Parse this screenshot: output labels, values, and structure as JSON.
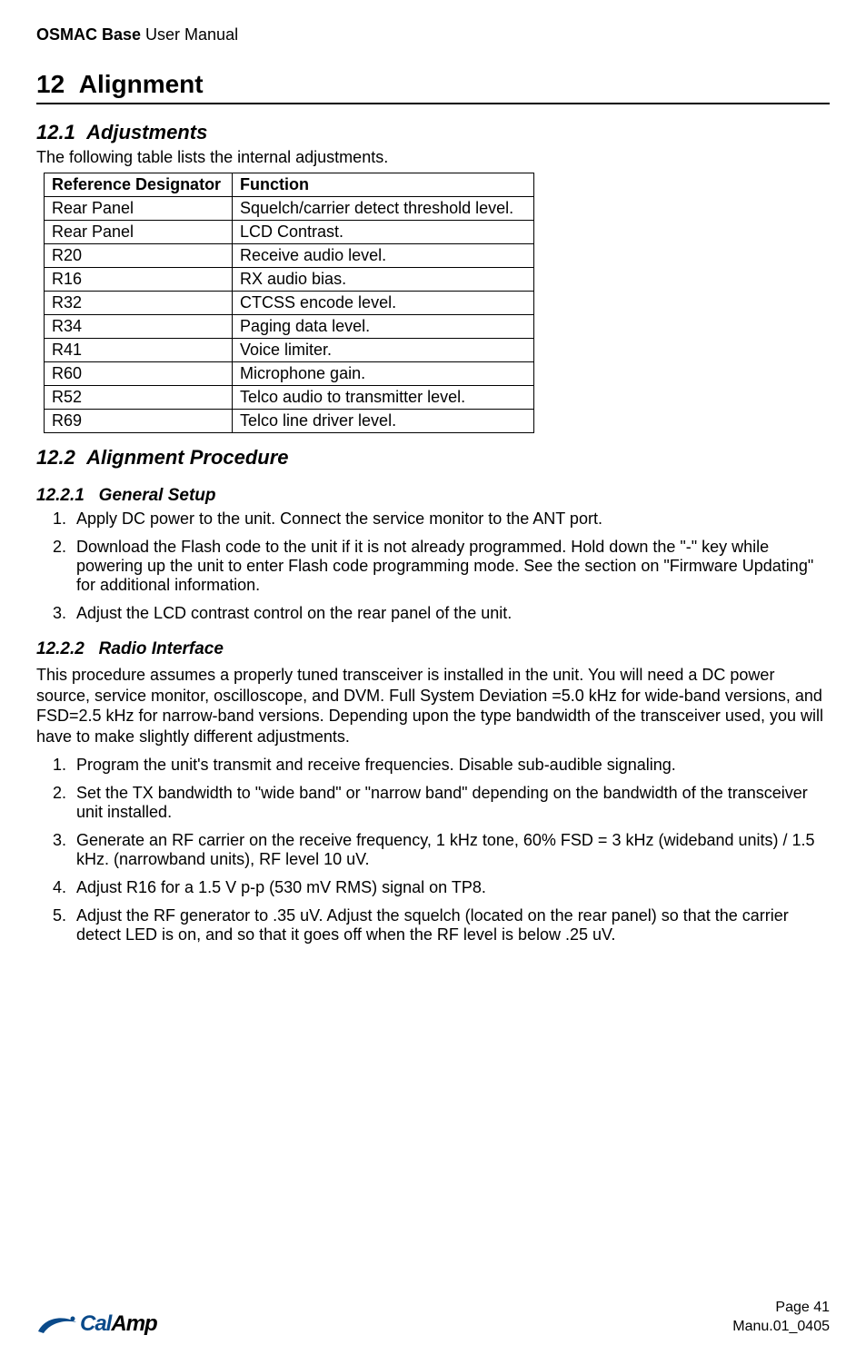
{
  "header": {
    "product_bold": "OSMAC Base",
    "product_rest": " User Manual"
  },
  "chapter": {
    "number": "12",
    "title": "Alignment"
  },
  "section1": {
    "number": "12.1",
    "title": "Adjustments",
    "lead": "The following table lists the internal adjustments.",
    "table": {
      "head": {
        "col1": "Reference Designator",
        "col2": "Function"
      },
      "rows": [
        {
          "col1": "Rear Panel",
          "col2": "Squelch/carrier detect threshold level."
        },
        {
          "col1": "Rear Panel",
          "col2": "LCD Contrast."
        },
        {
          "col1": "R20",
          "col2": "Receive audio level."
        },
        {
          "col1": "R16",
          "col2": "RX audio bias."
        },
        {
          "col1": "R32",
          "col2": "CTCSS encode level."
        },
        {
          "col1": "R34",
          "col2": "Paging data level."
        },
        {
          "col1": "R41",
          "col2": "Voice limiter."
        },
        {
          "col1": "R60",
          "col2": "Microphone gain."
        },
        {
          "col1": "R52",
          "col2": "Telco audio to transmitter level."
        },
        {
          "col1": "R69",
          "col2": "Telco line driver level."
        }
      ]
    }
  },
  "section2": {
    "number": "12.2",
    "title": "Alignment Procedure",
    "sub1": {
      "number": "12.2.1",
      "title": "General Setup",
      "items": [
        "Apply DC power to the unit.  Connect the service monitor to the ANT port.",
        "Download the Flash code to the unit if it is not already programmed.  Hold down the \"-\" key while powering up the unit to enter Flash code programming mode.  See the section on \"Firmware Updating\" for additional information.",
        "Adjust the LCD contrast control on the rear panel of the unit."
      ]
    },
    "sub2": {
      "number": "12.2.2",
      "title": "Radio Interface",
      "lead": "This procedure assumes a properly tuned transceiver is installed in the unit.  You will need a DC power source, service monitor, oscilloscope, and DVM.  Full System Deviation =5.0 kHz for wide-band versions, and FSD=2.5 kHz for narrow-band versions.  Depending upon the type bandwidth of the transceiver used, you will have to make slightly different adjustments.",
      "items": [
        "Program the unit's transmit and receive frequencies.  Disable sub-audible signaling.",
        "Set the TX bandwidth to \"wide band\" or \"narrow band\" depending on the bandwidth of the transceiver unit installed.",
        "Generate an RF carrier on the receive frequency, 1 kHz tone, 60% FSD = 3 kHz (wideband units) / 1.5 kHz. (narrowband units), RF level 10 uV.",
        "Adjust R16 for a 1.5 V p-p (530 mV RMS) signal on TP8.",
        "Adjust the RF generator to .35 uV.  Adjust the squelch (located on the rear panel) so that the carrier detect LED is on, and so that it goes off when the RF level is below .25 uV."
      ]
    }
  },
  "footer": {
    "page": "Page 41",
    "doc": "Manu.01_0405",
    "logo": {
      "part1": "Cal",
      "part2": "Amp"
    }
  }
}
